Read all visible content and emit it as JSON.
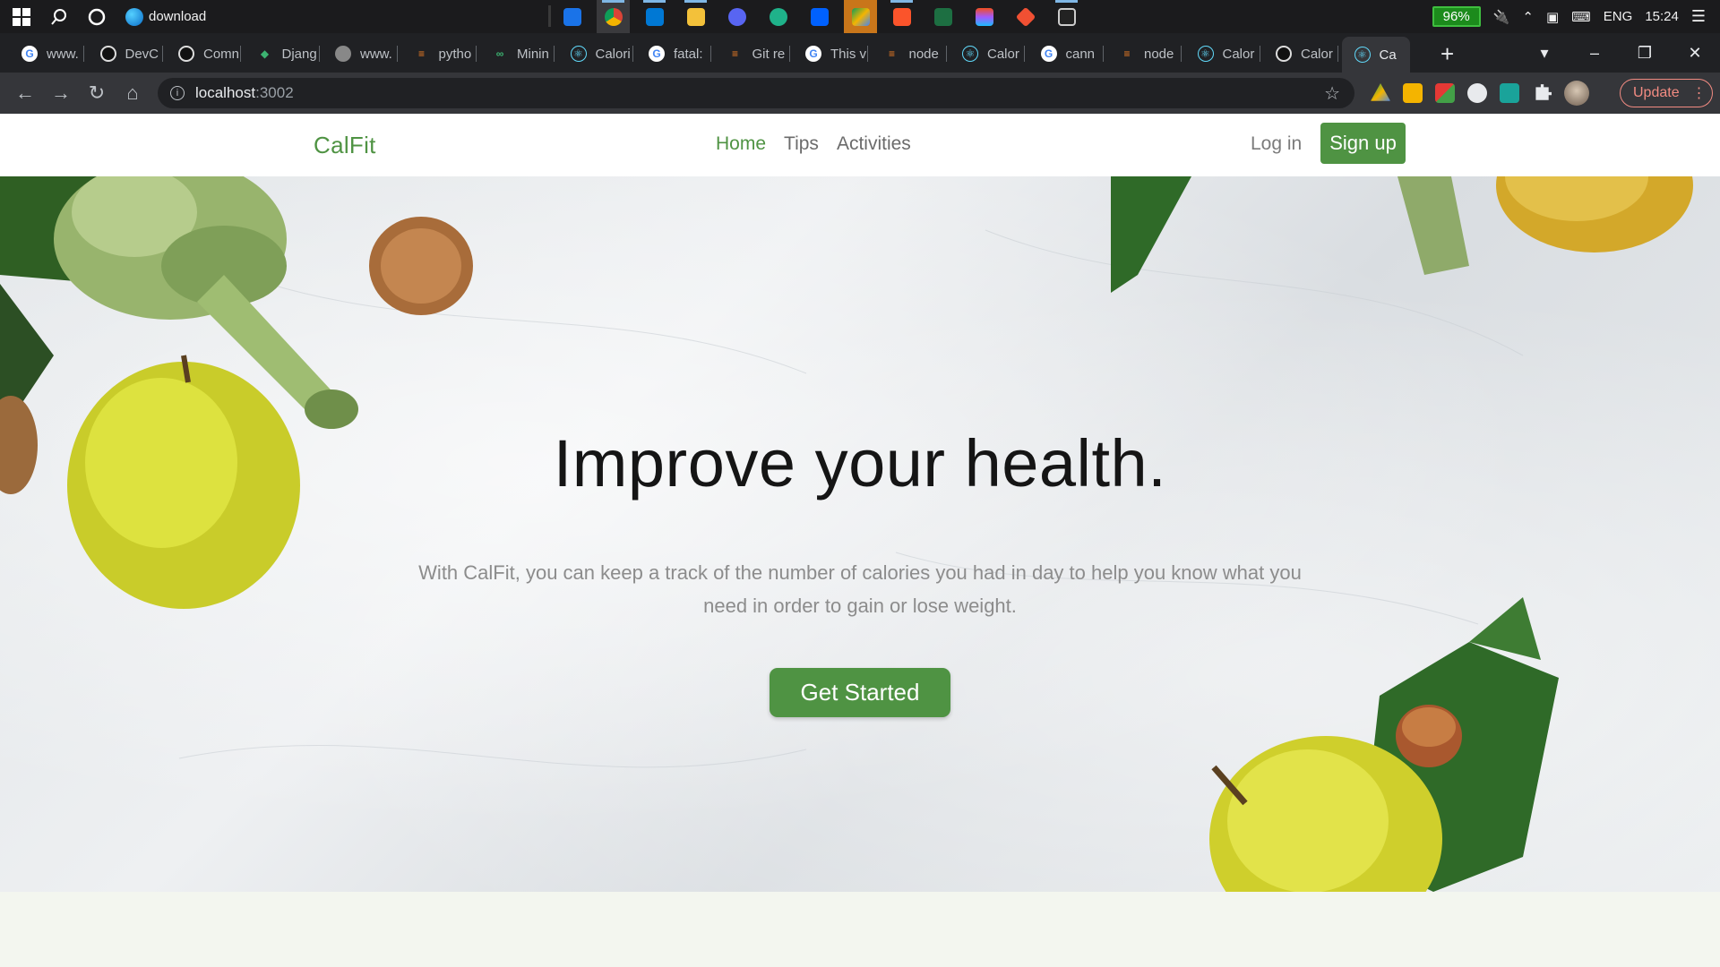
{
  "taskbar": {
    "download_label": "download",
    "battery": "96%",
    "language": "ENG",
    "time": "15:24"
  },
  "tabs": [
    {
      "label": "www.",
      "icon": "google-icon"
    },
    {
      "label": "DevC",
      "icon": "github-icon"
    },
    {
      "label": "Comn",
      "icon": "github-icon"
    },
    {
      "label": "Djang",
      "icon": "django-icon"
    },
    {
      "label": "www.",
      "icon": "web-icon"
    },
    {
      "label": "pytho",
      "icon": "stackoverflow-icon"
    },
    {
      "label": "Minin",
      "icon": "geeksforgeeks-icon"
    },
    {
      "label": "Calori",
      "icon": "react-icon"
    },
    {
      "label": "fatal:",
      "icon": "google-icon"
    },
    {
      "label": "Git re",
      "icon": "stackoverflow-icon"
    },
    {
      "label": "This v",
      "icon": "google-icon"
    },
    {
      "label": "node",
      "icon": "stackoverflow-icon"
    },
    {
      "label": "Calor",
      "icon": "react-icon"
    },
    {
      "label": "cann",
      "icon": "google-icon"
    },
    {
      "label": "node",
      "icon": "stackoverflow-icon"
    },
    {
      "label": "Calor",
      "icon": "react-icon"
    },
    {
      "label": "Calor",
      "icon": "github-icon"
    },
    {
      "label": "Ca",
      "icon": "react-icon"
    }
  ],
  "address": {
    "host": "localhost",
    "port": ":3002"
  },
  "update_label": "Update",
  "site": {
    "brand": "CalFit",
    "nav": [
      "Home",
      "Tips",
      "Activities"
    ],
    "login": "Log in",
    "signup": "Sign up",
    "hero_title": "Improve your health.",
    "hero_text": "With CalFit, you can keep a track of the number of calories you had in day to help you know what you need in order to gain or lose weight.",
    "cta": "Get Started"
  },
  "colors": {
    "brand_green": "#4f9343",
    "taskbar_bg": "#1b1b1d",
    "tabstrip_bg": "#202124",
    "toolbar_bg": "#35363a",
    "page_bottom_bg": "#f3f6ef"
  }
}
